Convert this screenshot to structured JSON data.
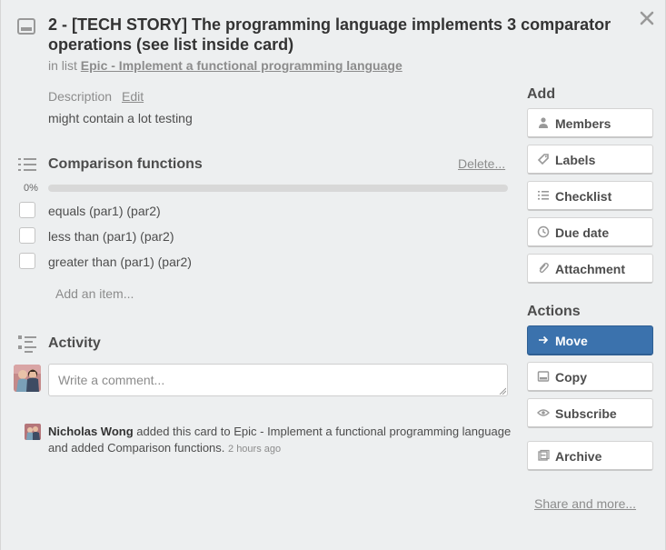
{
  "card": {
    "title": "2 - [TECH STORY] The programming language implements 3 comparator operations (see list inside card)",
    "in_list_prefix": "in list",
    "list_name": "Epic - Implement a functional programming language"
  },
  "description": {
    "label": "Description",
    "edit_label": "Edit",
    "text": "might contain a lot testing"
  },
  "checklist": {
    "title": "Comparison functions",
    "delete_label": "Delete...",
    "percent_label": "0%",
    "progress": 0,
    "items": [
      {
        "label": "equals (par1) (par2)",
        "checked": false
      },
      {
        "label": "less than (par1) (par2)",
        "checked": false
      },
      {
        "label": "greater than (par1) (par2)",
        "checked": false
      }
    ],
    "add_item_placeholder": "Add an item..."
  },
  "activity": {
    "title": "Activity",
    "comment_placeholder": "Write a comment...",
    "entries": [
      {
        "author": "Nicholas Wong",
        "text": " added this card to Epic - Implement a functional programming language and added Comparison functions. ",
        "time": "2 hours ago"
      }
    ]
  },
  "sidebar": {
    "add_heading": "Add",
    "add_buttons": [
      {
        "label": "Members",
        "icon": "person-icon"
      },
      {
        "label": "Labels",
        "icon": "tag-icon"
      },
      {
        "label": "Checklist",
        "icon": "checklist-icon"
      },
      {
        "label": "Due date",
        "icon": "clock-icon"
      },
      {
        "label": "Attachment",
        "icon": "paperclip-icon"
      }
    ],
    "actions_heading": "Actions",
    "action_buttons": [
      {
        "label": "Move",
        "icon": "arrow-right-icon"
      },
      {
        "label": "Copy",
        "icon": "card-icon"
      },
      {
        "label": "Subscribe",
        "icon": "eye-icon"
      },
      {
        "label": "Archive",
        "icon": "archive-icon"
      }
    ],
    "share_label": "Share and more..."
  },
  "colors": {
    "primary_button": "#3b72ad",
    "background": "#edeff0",
    "muted_text": "#8c8c8c"
  }
}
